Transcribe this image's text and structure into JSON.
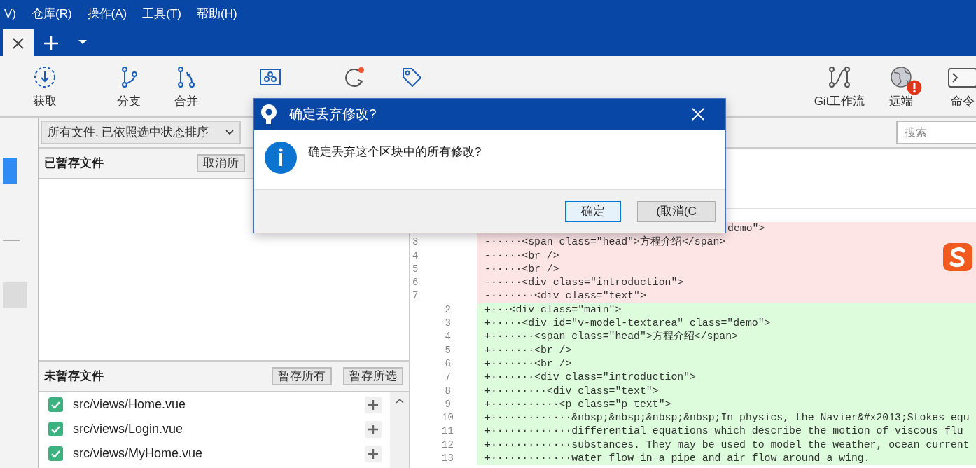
{
  "menu": [
    "V)",
    "仓库(R)",
    "操作(A)",
    "工具(T)",
    "帮助(H)"
  ],
  "toolbar": {
    "left": [
      {
        "kind": "fetch",
        "label": "获取"
      },
      {
        "kind": "branch",
        "label": "分支"
      },
      {
        "kind": "merge",
        "label": "合并"
      },
      {
        "kind": "stash"
      },
      {
        "kind": "discard"
      },
      {
        "kind": "tag"
      }
    ],
    "right": [
      {
        "kind": "flow",
        "label": "Git工作流"
      },
      {
        "kind": "remote",
        "label": "远端",
        "alert": true
      },
      {
        "kind": "terminal",
        "label": "命令"
      }
    ]
  },
  "filter": {
    "sort_dropdown": "所有文件, 已依照选中状态排序"
  },
  "search": {
    "placeholder": "搜索"
  },
  "staged": {
    "title": "已暂存文件",
    "button": "取消所"
  },
  "unstaged": {
    "title": "未暂存文件",
    "buttons": [
      "暂存所有",
      "暂存所选"
    ],
    "files": [
      {
        "path": "src/views/Home.vue",
        "checked": true
      },
      {
        "path": "src/views/Login.vue",
        "checked": true
      },
      {
        "path": "src/views/MyHome.vue",
        "checked": true
      }
    ]
  },
  "diff": [
    {
      "kind": "removed",
      "covered": true,
      "code": "demo\">"
    },
    {
      "kind": "removed",
      "old": "3",
      "code": "-·····<span class=\"head\">方程介绍</span>"
    },
    {
      "kind": "removed",
      "old": "4",
      "code": "-·····<br />"
    },
    {
      "kind": "removed",
      "old": "5",
      "code": "-·····<br />"
    },
    {
      "kind": "removed",
      "old": "6",
      "code": "-·····<div class=\"introduction\">"
    },
    {
      "kind": "removed",
      "old": "7",
      "code": "-·······<div class=\"text\">"
    },
    {
      "kind": "added",
      "new": "2",
      "code": "+···<div class=\"main\">"
    },
    {
      "kind": "added",
      "new": "3",
      "code": "+·····<div id=\"v-model-textarea\" class=\"demo\">"
    },
    {
      "kind": "added",
      "new": "4",
      "code": "+·······<span class=\"head\">方程介绍</span>"
    },
    {
      "kind": "added",
      "new": "5",
      "code": "+·······<br />"
    },
    {
      "kind": "added",
      "new": "6",
      "code": "+·······<br />"
    },
    {
      "kind": "added",
      "new": "7",
      "code": "+·······<div class=\"introduction\">"
    },
    {
      "kind": "added",
      "new": "8",
      "code": "+·········<div class=\"text\">"
    },
    {
      "kind": "added",
      "new": "9",
      "code": "+···········<p class=\"p_text\">"
    },
    {
      "kind": "added",
      "new": "10",
      "code": "+·············&nbsp;&nbsp;&nbsp;&nbsp;In physics, the Navier&#x2013;Stokes equ"
    },
    {
      "kind": "added",
      "new": "11",
      "code": "+·············differential equations which describe the motion of viscous flu"
    },
    {
      "kind": "added",
      "new": "12",
      "code": "+·············substances. They may be used to model the weather, ocean current"
    },
    {
      "kind": "added",
      "new": "13",
      "code": "+·············water flow in a pipe and air flow around a wing."
    }
  ],
  "dialog": {
    "title": "确定丢弃修改?",
    "message": "确定丢弃这个区块中的所有修改?",
    "buttons": [
      {
        "label": "确定",
        "default": true
      },
      {
        "label": "(取消(C",
        "default": false
      }
    ]
  }
}
